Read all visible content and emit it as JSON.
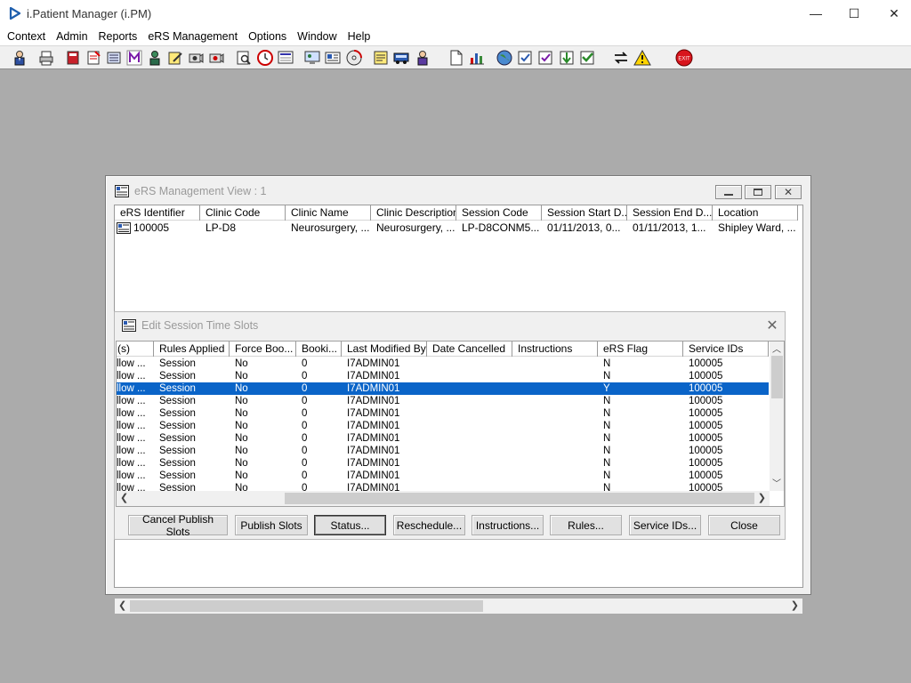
{
  "window": {
    "title": "i.Patient Manager (i.PM)",
    "minimize": "—",
    "maximize": "☐",
    "close": "✕"
  },
  "menu": [
    "Context",
    "Admin",
    "Reports",
    "eRS Management",
    "Options",
    "Window",
    "Help"
  ],
  "toolbar_icons": [
    "patient-icon",
    "printer-icon",
    "book-icon",
    "notes-icon",
    "list-icon",
    "letter-m-icon",
    "person-icon",
    "edit-icon",
    "camera-icon",
    "camera2-icon",
    "search-doc-icon",
    "clock-icon",
    "screen-icon",
    "monitor-icon",
    "card-icon",
    "cd-icon",
    "notepad-icon",
    "bus-icon",
    "transfer-icon",
    "document-icon",
    "chart-icon",
    "globe-icon",
    "check-doc-icon",
    "check-doc2-icon",
    "arrow-down-icon",
    "arrow-check-icon",
    "swap-icon",
    "warning-icon",
    "exit-icon"
  ],
  "ers": {
    "title": "eRS Management View : 1",
    "columns": [
      "eRS Identifier",
      "Clinic Code",
      "Clinic Name",
      "Clinic Description",
      "Session Code",
      "Session Start D...",
      "Session End D...",
      "Location"
    ],
    "rows": [
      [
        "100005",
        "LP-D8",
        "Neurosurgery, ...",
        "Neurosurgery, ...",
        "LP-D8CONM5...",
        "01/11/2013, 0...",
        "01/11/2013, 1...",
        "Shipley Ward, ..."
      ]
    ]
  },
  "slots": {
    "title": "Edit Session Time Slots",
    "columns": [
      "(s)",
      "Rules Applied",
      "Force Boo...",
      "Booki...",
      "Last Modified By",
      "Date Cancelled",
      "Instructions",
      "eRS Flag",
      "Service IDs"
    ],
    "rows": [
      [
        "llow ...",
        "Session",
        "No",
        "0",
        "I7ADMIN01",
        "",
        "",
        "N",
        "100005"
      ],
      [
        "llow ...",
        "Session",
        "No",
        "0",
        "I7ADMIN01",
        "",
        "",
        "N",
        "100005"
      ],
      [
        "llow ...",
        "Session",
        "No",
        "0",
        "I7ADMIN01",
        "",
        "",
        "Y",
        "100005"
      ],
      [
        "llow ...",
        "Session",
        "No",
        "0",
        "I7ADMIN01",
        "",
        "",
        "N",
        "100005"
      ],
      [
        "llow ...",
        "Session",
        "No",
        "0",
        "I7ADMIN01",
        "",
        "",
        "N",
        "100005"
      ],
      [
        "llow ...",
        "Session",
        "No",
        "0",
        "I7ADMIN01",
        "",
        "",
        "N",
        "100005"
      ],
      [
        "llow ...",
        "Session",
        "No",
        "0",
        "I7ADMIN01",
        "",
        "",
        "N",
        "100005"
      ],
      [
        "llow ...",
        "Session",
        "No",
        "0",
        "I7ADMIN01",
        "",
        "",
        "N",
        "100005"
      ],
      [
        "llow ...",
        "Session",
        "No",
        "0",
        "I7ADMIN01",
        "",
        "",
        "N",
        "100005"
      ],
      [
        "llow ...",
        "Session",
        "No",
        "0",
        "I7ADMIN01",
        "",
        "",
        "N",
        "100005"
      ],
      [
        "llow ...",
        "Session",
        "No",
        "0",
        "I7ADMIN01",
        "",
        "",
        "N",
        "100005"
      ]
    ],
    "selected_row": 2,
    "buttons": [
      "Cancel Publish Slots",
      "Publish Slots",
      "Status...",
      "Reschedule...",
      "Instructions...",
      "Rules...",
      "Service IDs...",
      "Close"
    ]
  },
  "colors": {
    "selection": "#0a64c8",
    "desktop": "#ababab"
  }
}
